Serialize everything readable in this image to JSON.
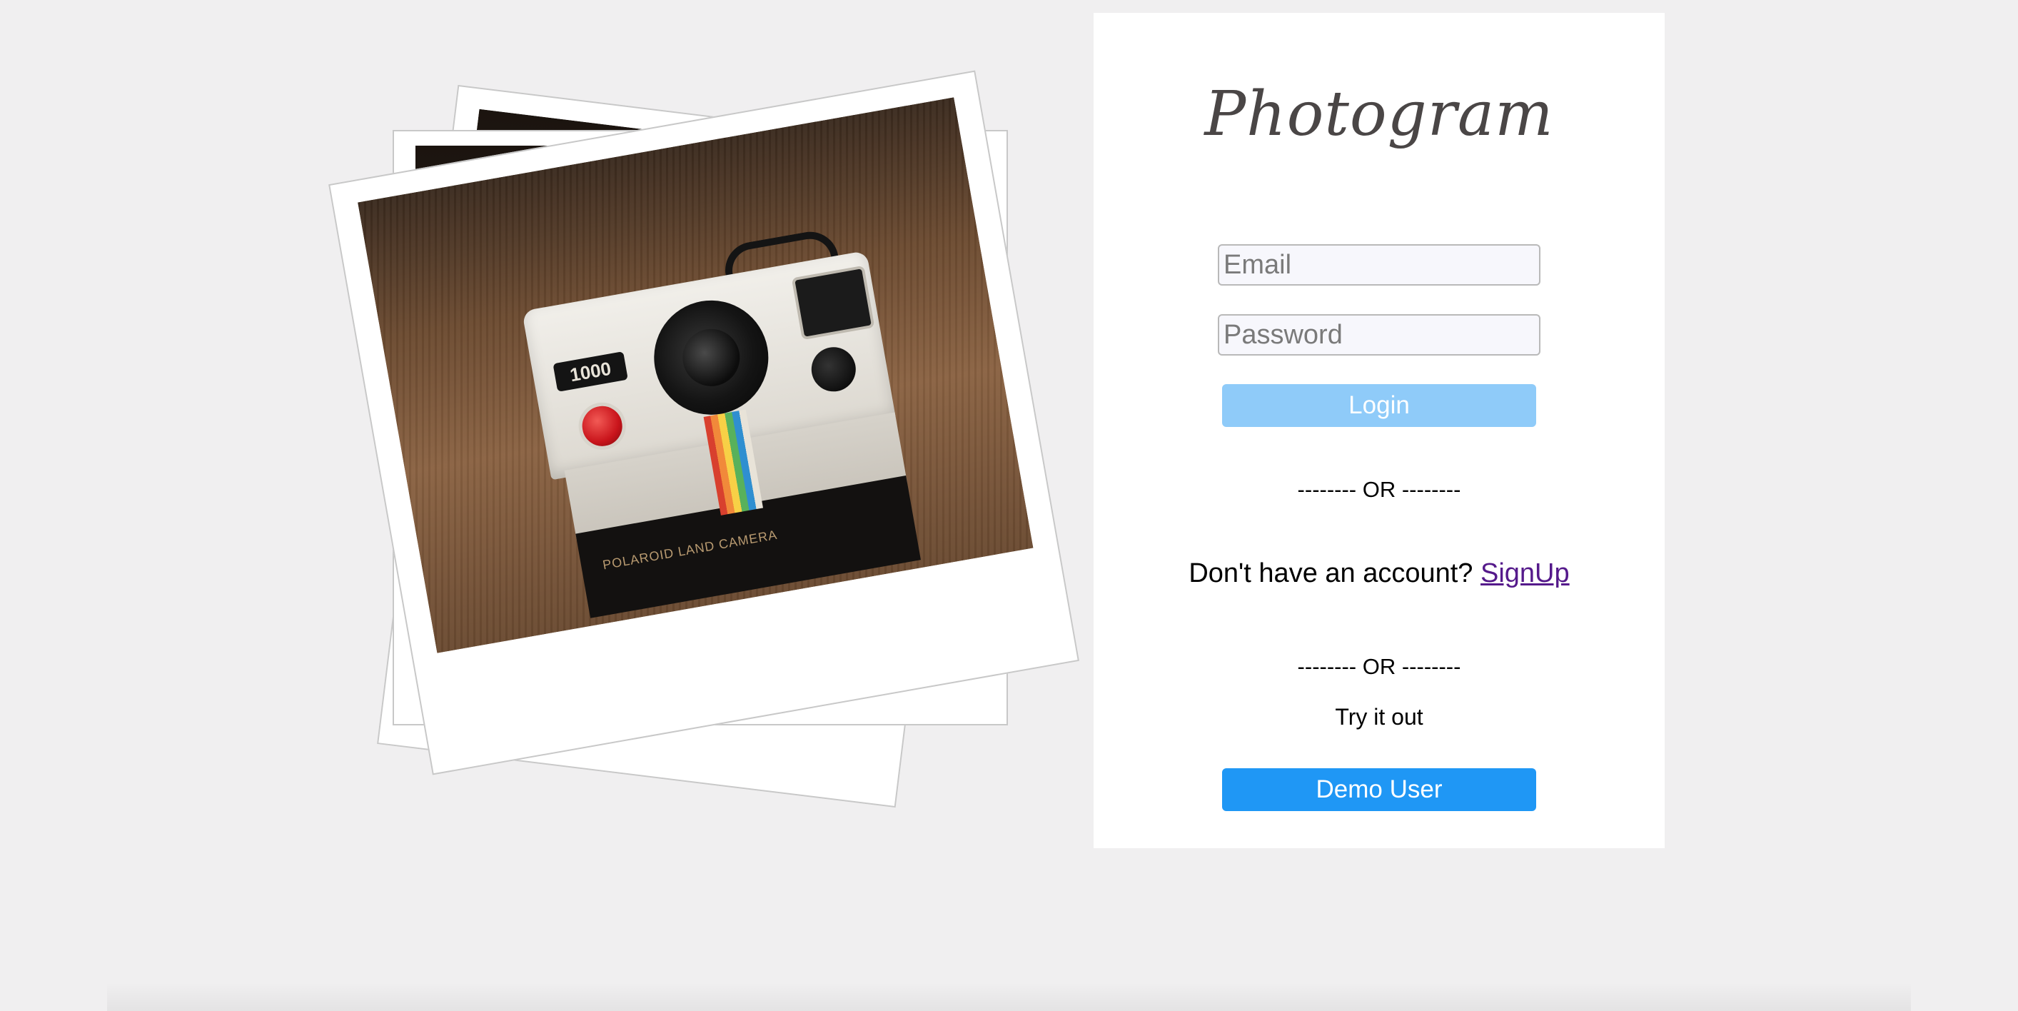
{
  "app": {
    "logo_text": "Photogram"
  },
  "login_form": {
    "email_placeholder": "Email",
    "email_value": "",
    "password_placeholder": "Password",
    "password_value": "",
    "login_label": "Login"
  },
  "divider": {
    "first": "-------- OR --------",
    "second": "-------- OR --------"
  },
  "signup": {
    "prompt": "Don't have an account? ",
    "link_label": "SignUp"
  },
  "demo": {
    "try_text": "Try it out",
    "button_label": "Demo User"
  },
  "hero_photo": {
    "camera_badge": "1000",
    "camera_brand": "POLAROID LAND CAMERA"
  },
  "colors": {
    "login_button": "#8fcbf9",
    "demo_button": "#1f97f5",
    "link": "#551a8b",
    "background": "#f0eff0"
  }
}
